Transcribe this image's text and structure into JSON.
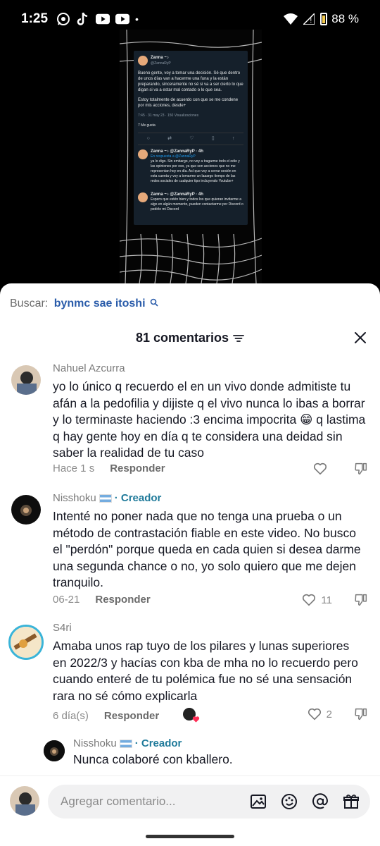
{
  "status_bar": {
    "time": "1:25",
    "dot": "•",
    "battery": "88 %",
    "icons_left": [
      "whatsapp-icon",
      "tiktok-icon",
      "youtube-icon",
      "youtube-icon"
    ],
    "icons_right": [
      "wifi-icon",
      "signal-icon",
      "battery-icon"
    ]
  },
  "video": {
    "tweet": {
      "name": "Zanna ~♪",
      "handle": "@ZannaRyP",
      "text1": "Bueno gente, voy a tomar una decisión. Sé que dentro de unos días van a hacerme una funa y la están preparando, sinceramente no sé si va a ser cierto lo que digan si va a estar mal contado o lo que sea.",
      "text2": "Estoy totalmente de acuerdo con que se me condene por mis acciones, desde+",
      "meta": "7:45 · 31 may 23 · 150 Visualizaciones",
      "likes": "7 Me gusta",
      "reply1_header": "Zanna ~♪ @ZannaRyP · 4h",
      "reply1_to": "En respuesta a @ZannaRyP",
      "reply1_text": "ya lo digo. Sin embargo, no voy a tragarme todo el odio y las opiniones por eso, ya que son acciones que no me representan hoy en día. Así que voy a cerrar sesión en esta cuenta y voy a tomarme un laaargo tiempo de las redes sociales de cualquier tipo incluyendo Youtube+",
      "reply2_header": "Zanna ~♪ @ZannaRyP · 4h",
      "reply2_text": "Espero que estén bien y todos los que quieran invitarme a algo en algún momento, pueden contactarme por Discord o pedirle mi Discord"
    }
  },
  "search": {
    "label": "Buscar:",
    "query": "bynmc sae itoshi"
  },
  "header": {
    "count_label": "81 comentarios"
  },
  "comments": [
    {
      "user": "Nahuel Azcurra",
      "text": "yo lo único q recuerdo el en un vivo donde admitiste tu afán a la pedofilia y dijiste q el vivo nunca lo ibas a borrar y lo terminaste haciendo :3 encima impocrita 😁 q lastima q hay gente hoy en día q te considera una deidad sin saber la realidad de tu caso",
      "time": "Hace 1 s",
      "reply": "Responder",
      "likes": ""
    },
    {
      "user": "Nisshoku",
      "creator": "· Creador",
      "text": "Intenté no poner nada que no tenga una prueba o un método de contrastación fiable en este video. No busco el \"perdón\" porque queda en cada quien si desea darme una segunda chance o no, yo solo quiero que me dejen tranquilo.",
      "time": "06-21",
      "reply": "Responder",
      "likes": "11"
    },
    {
      "user": "S4ri",
      "text": "Amaba unos rap tuyo de los pilares y lunas superiores en 2022/3 y hacías con kba de mha no lo recuerdo pero cuando enteré de tu polémica fue no sé una sensación rara no sé cómo explicarla",
      "time": "6 día(s)",
      "reply": "Responder",
      "likes": "2"
    }
  ],
  "reply": {
    "user": "Nisshoku",
    "creator": "· Creador",
    "text": "Nunca colaboré con kballero."
  },
  "input": {
    "placeholder": "Agregar comentario..."
  }
}
